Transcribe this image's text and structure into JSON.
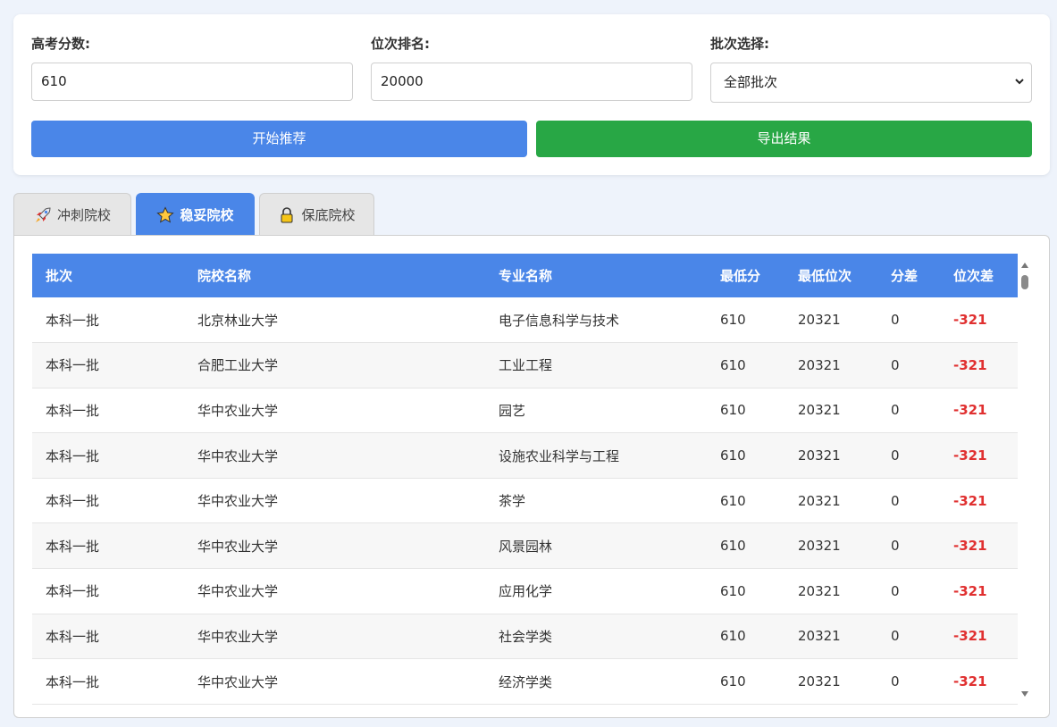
{
  "form": {
    "score_label": "高考分数:",
    "score_value": "610",
    "rank_label": "位次排名:",
    "rank_value": "20000",
    "batch_label": "批次选择:",
    "batch_selected": "全部批次"
  },
  "buttons": {
    "recommend": "开始推荐",
    "export": "导出结果"
  },
  "colors": {
    "primary": "#4a86e8",
    "success": "#28a745",
    "negative": "#e03030"
  },
  "tabs": [
    {
      "label": "冲刺院校",
      "icon": "rocket-icon",
      "active": false
    },
    {
      "label": "稳妥院校",
      "icon": "star-icon",
      "active": true
    },
    {
      "label": "保底院校",
      "icon": "lock-icon",
      "active": false
    }
  ],
  "table": {
    "headers": [
      "批次",
      "院校名称",
      "专业名称",
      "最低分",
      "最低位次",
      "分差",
      "位次差"
    ],
    "rows": [
      [
        "本科一批",
        "北京林业大学",
        "电子信息科学与技术",
        "610",
        "20321",
        "0",
        "-321"
      ],
      [
        "本科一批",
        "合肥工业大学",
        "工业工程",
        "610",
        "20321",
        "0",
        "-321"
      ],
      [
        "本科一批",
        "华中农业大学",
        "园艺",
        "610",
        "20321",
        "0",
        "-321"
      ],
      [
        "本科一批",
        "华中农业大学",
        "设施农业科学与工程",
        "610",
        "20321",
        "0",
        "-321"
      ],
      [
        "本科一批",
        "华中农业大学",
        "茶学",
        "610",
        "20321",
        "0",
        "-321"
      ],
      [
        "本科一批",
        "华中农业大学",
        "风景园林",
        "610",
        "20321",
        "0",
        "-321"
      ],
      [
        "本科一批",
        "华中农业大学",
        "应用化学",
        "610",
        "20321",
        "0",
        "-321"
      ],
      [
        "本科一批",
        "华中农业大学",
        "社会学类",
        "610",
        "20321",
        "0",
        "-321"
      ],
      [
        "本科一批",
        "华中农业大学",
        "经济学类",
        "610",
        "20321",
        "0",
        "-321"
      ]
    ]
  }
}
